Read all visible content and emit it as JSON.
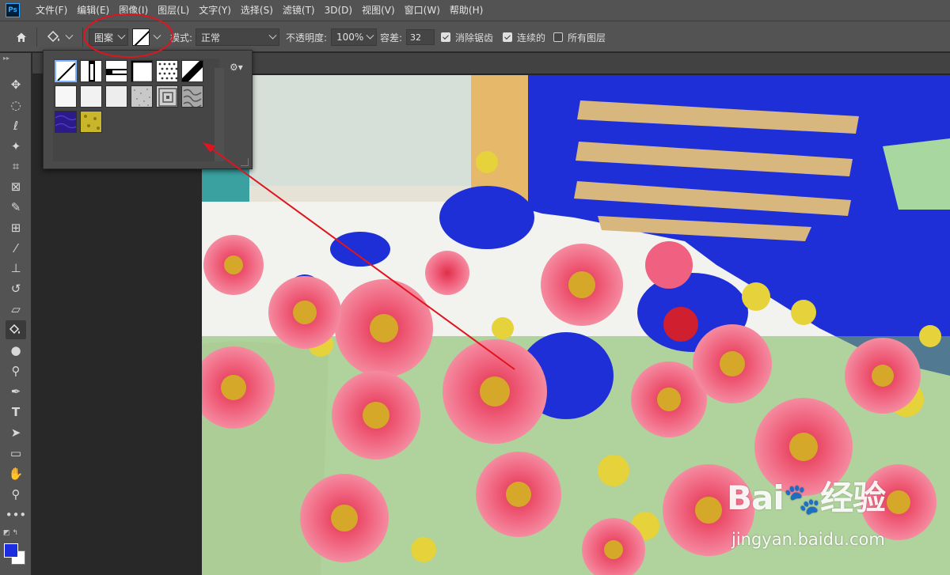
{
  "app": {
    "logo_text": "Ps"
  },
  "menu": [
    "文件(F)",
    "编辑(E)",
    "图像(I)",
    "图层(L)",
    "文字(Y)",
    "选择(S)",
    "滤镜(T)",
    "3D(D)",
    "视图(V)",
    "窗口(W)",
    "帮助(H)"
  ],
  "options": {
    "fill_source": "图案",
    "mode_label": "模式:",
    "mode_value": "正常",
    "opacity_label": "不透明度:",
    "opacity_value": "100%",
    "tolerance_label": "容差:",
    "tolerance_value": "32",
    "antialias_label": "消除锯齿",
    "antialias_checked": true,
    "contiguous_label": "连续的",
    "contiguous_checked": true,
    "all_layers_label": "所有图层",
    "all_layers_checked": false
  },
  "tools": [
    "move",
    "elliptical-marquee",
    "lasso",
    "magic-wand",
    "crop",
    "frame",
    "eyedropper",
    "healing-brush",
    "brush",
    "clone-stamp",
    "history-brush",
    "eraser",
    "paint-bucket",
    "blur",
    "dodge",
    "pen",
    "type",
    "path-selection",
    "rectangle",
    "hand",
    "zoom",
    "more"
  ],
  "active_tool": "paint-bucket",
  "colors": {
    "foreground": "#1c2de0",
    "background": "#ffffff",
    "annotation": "#e0141e"
  },
  "pattern_picker": {
    "selected_index": 0,
    "pattern_count": 14
  },
  "watermark": {
    "logo_latin": "Bai",
    "logo_suffix": "经验",
    "url": "jingyan.baidu.com"
  }
}
